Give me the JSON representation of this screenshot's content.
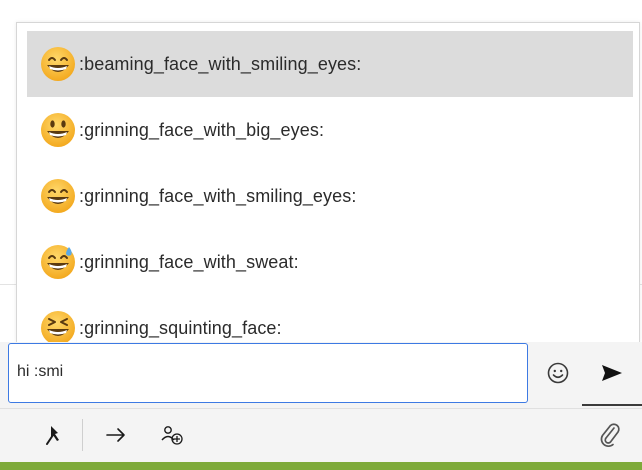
{
  "emoji_suggestions": [
    {
      "icon": "beaming-face-emoji",
      "code": ":beaming_face_with_smiling_eyes:",
      "selected": true
    },
    {
      "icon": "grinning-face-big-eyes-emoji",
      "code": ":grinning_face_with_big_eyes:",
      "selected": false
    },
    {
      "icon": "grinning-face-smiling-eyes-emoji",
      "code": ":grinning_face_with_smiling_eyes:",
      "selected": false
    },
    {
      "icon": "grinning-face-sweat-emoji",
      "code": ":grinning_face_with_sweat:",
      "selected": false
    },
    {
      "icon": "grinning-squinting-face-emoji",
      "code": ":grinning_squinting_face:",
      "selected": false
    }
  ],
  "composer": {
    "value": "hi :smi",
    "emoji_button_icon": "smiley-icon",
    "send_button_icon": "send-icon"
  },
  "toolbar": {
    "items": [
      "pin-icon",
      "arrow-right-icon",
      "add-participant-icon",
      "paperclip-icon"
    ]
  },
  "colors": {
    "accent": "#3d7ae3",
    "selected_row": "#dcdcdc",
    "bottom_bar": "#7eaa3a"
  }
}
